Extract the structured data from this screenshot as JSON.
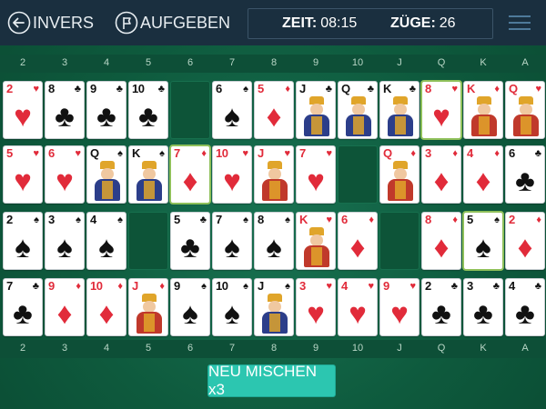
{
  "toolbar": {
    "undo_label": "INVERS",
    "give_up_label": "AUFGEBEN",
    "time_label": "ZEIT:",
    "time_value": "08:15",
    "moves_label": "ZÜGE:",
    "moves_value": "26",
    "undo_icon": "arrow-left-circle-icon",
    "give_up_icon": "flag-circle-icon",
    "menu_icon": "hamburger-menu-icon"
  },
  "rank_labels": [
    "2",
    "3",
    "4",
    "5",
    "6",
    "7",
    "8",
    "9",
    "10",
    "J",
    "Q",
    "K",
    "A"
  ],
  "colors": {
    "felt": "#0f5a3e",
    "topbar": "#1a2f3f",
    "button": "#2cc6b0",
    "red": "#e12b3a",
    "black": "#111111"
  },
  "rows": [
    [
      {
        "rank": "2",
        "suit": "♥",
        "color": "red"
      },
      {
        "rank": "8",
        "suit": "♣",
        "color": "black"
      },
      {
        "rank": "9",
        "suit": "♣",
        "color": "black"
      },
      {
        "rank": "10",
        "suit": "♣",
        "color": "black"
      },
      null,
      {
        "rank": "6",
        "suit": "♠",
        "color": "black"
      },
      {
        "rank": "5",
        "suit": "♦",
        "color": "red"
      },
      {
        "rank": "J",
        "suit": "♣",
        "color": "black",
        "face": true
      },
      {
        "rank": "Q",
        "suit": "♣",
        "color": "black",
        "face": true
      },
      {
        "rank": "K",
        "suit": "♣",
        "color": "black",
        "face": true
      },
      {
        "rank": "8",
        "suit": "♥",
        "color": "red",
        "selected": true
      },
      {
        "rank": "K",
        "suit": "♦",
        "color": "red",
        "face": true
      },
      {
        "rank": "Q",
        "suit": "♥",
        "color": "red",
        "face": true
      }
    ],
    [
      {
        "rank": "5",
        "suit": "♥",
        "color": "red"
      },
      {
        "rank": "6",
        "suit": "♥",
        "color": "red"
      },
      {
        "rank": "Q",
        "suit": "♠",
        "color": "black",
        "face": true
      },
      {
        "rank": "K",
        "suit": "♠",
        "color": "black",
        "face": true
      },
      {
        "rank": "7",
        "suit": "♦",
        "color": "red",
        "selected": true
      },
      {
        "rank": "10",
        "suit": "♥",
        "color": "red"
      },
      {
        "rank": "J",
        "suit": "♥",
        "color": "red",
        "face": true
      },
      {
        "rank": "7",
        "suit": "♥",
        "color": "red"
      },
      null,
      {
        "rank": "Q",
        "suit": "♦",
        "color": "red",
        "face": true
      },
      {
        "rank": "3",
        "suit": "♦",
        "color": "red"
      },
      {
        "rank": "4",
        "suit": "♦",
        "color": "red"
      },
      {
        "rank": "6",
        "suit": "♣",
        "color": "black"
      }
    ],
    [
      {
        "rank": "2",
        "suit": "♠",
        "color": "black"
      },
      {
        "rank": "3",
        "suit": "♠",
        "color": "black"
      },
      {
        "rank": "4",
        "suit": "♠",
        "color": "black"
      },
      null,
      {
        "rank": "5",
        "suit": "♣",
        "color": "black"
      },
      {
        "rank": "7",
        "suit": "♠",
        "color": "black"
      },
      {
        "rank": "8",
        "suit": "♠",
        "color": "black"
      },
      {
        "rank": "K",
        "suit": "♥",
        "color": "red",
        "face": true
      },
      {
        "rank": "6",
        "suit": "♦",
        "color": "red"
      },
      null,
      {
        "rank": "8",
        "suit": "♦",
        "color": "red"
      },
      {
        "rank": "5",
        "suit": "♠",
        "color": "black",
        "selected": true
      },
      {
        "rank": "2",
        "suit": "♦",
        "color": "red"
      }
    ],
    [
      {
        "rank": "7",
        "suit": "♣",
        "color": "black"
      },
      {
        "rank": "9",
        "suit": "♦",
        "color": "red"
      },
      {
        "rank": "10",
        "suit": "♦",
        "color": "red"
      },
      {
        "rank": "J",
        "suit": "♦",
        "color": "red",
        "face": true
      },
      {
        "rank": "9",
        "suit": "♠",
        "color": "black"
      },
      {
        "rank": "10",
        "suit": "♠",
        "color": "black"
      },
      {
        "rank": "J",
        "suit": "♠",
        "color": "black",
        "face": true
      },
      {
        "rank": "3",
        "suit": "♥",
        "color": "red"
      },
      {
        "rank": "4",
        "suit": "♥",
        "color": "red"
      },
      {
        "rank": "9",
        "suit": "♥",
        "color": "red"
      },
      {
        "rank": "2",
        "suit": "♣",
        "color": "black"
      },
      {
        "rank": "3",
        "suit": "♣",
        "color": "black"
      },
      {
        "rank": "4",
        "suit": "♣",
        "color": "black"
      }
    ]
  ],
  "shuffle_button": "NEU MISCHEN x3"
}
